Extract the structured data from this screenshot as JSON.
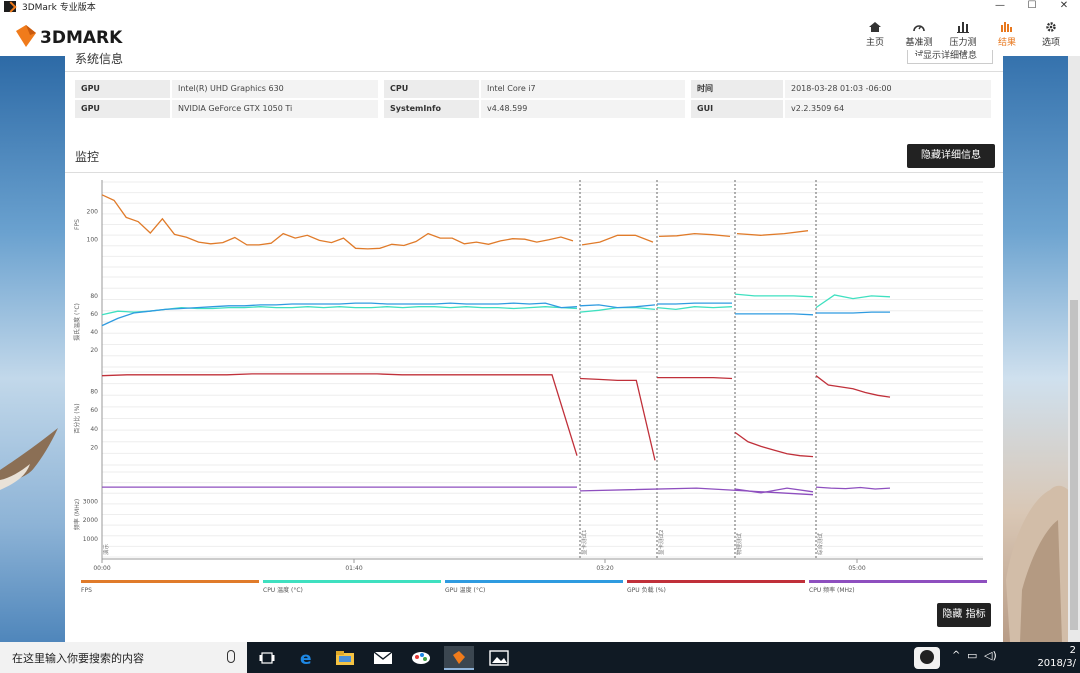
{
  "window": {
    "title": "3DMark 专业版本"
  },
  "app": {
    "logo_text": "3DMARK"
  },
  "nav": [
    {
      "label": "主页",
      "icon": "home-icon"
    },
    {
      "label": "基准测试",
      "icon": "gauge-icon"
    },
    {
      "label": "压力测试",
      "icon": "bars-icon"
    },
    {
      "label": "结果",
      "icon": "results-icon",
      "active": true
    },
    {
      "label": "选项",
      "icon": "gear-icon"
    }
  ],
  "system": {
    "section_title": "系统信息",
    "show_details": "显示详细信息",
    "rows": [
      [
        {
          "k": "GPU",
          "v": "Intel(R) UHD Graphics 630"
        },
        {
          "k": "CPU",
          "v": "Intel Core i7"
        },
        {
          "k": "时间",
          "v": "2018-03-28 01:03 -06:00"
        }
      ],
      [
        {
          "k": "GPU",
          "v": "NVIDIA GeForce GTX 1050 Ti"
        },
        {
          "k": "SystemInfo",
          "v": "v4.48.599"
        },
        {
          "k": "GUI",
          "v": "v2.2.3509 64"
        }
      ]
    ]
  },
  "monitor": {
    "title": "监控",
    "hide_details": "隐藏详细信息",
    "hide_metrics": "隐藏 指标"
  },
  "chart_data": {
    "type": "line",
    "x_ticks": [
      "00:00",
      "01:40",
      "03:20",
      "05:00"
    ],
    "markers": [
      "演示",
      "显卡测试1",
      "显卡测试2",
      "物理测试",
      "综合测试"
    ],
    "panels": [
      {
        "ylabel": "FPS",
        "yticks": [
          100,
          200
        ]
      },
      {
        "ylabel": "摄氏温度 (°C)",
        "yticks": [
          20,
          40,
          60,
          80
        ]
      },
      {
        "ylabel": "百分比 (%)",
        "yticks": [
          20,
          40,
          60,
          80
        ]
      },
      {
        "ylabel": "频率 (MHz)",
        "yticks": [
          1000,
          2000,
          3000
        ]
      }
    ],
    "series": [
      {
        "name": "FPS",
        "color": "#e07b2a"
      },
      {
        "name": "CPU 温度 (°C)",
        "color": "#3fe0c0"
      },
      {
        "name": "GPU 温度 (°C)",
        "color": "#2f9be0"
      },
      {
        "name": "GPU 负载 (%)",
        "color": "#c0303a"
      },
      {
        "name": "CPU 频率 (MHz)",
        "color": "#8e4fbf"
      }
    ],
    "fps_y": [
      255,
      235,
      175,
      160,
      120,
      170,
      115,
      105,
      88,
      82,
      86,
      104,
      78,
      78,
      84,
      118,
      102,
      112,
      94,
      86,
      102,
      66,
      64,
      66,
      80,
      76,
      90,
      118,
      102,
      102,
      82,
      88,
      80,
      92,
      100,
      98,
      88,
      96,
      106,
      92,
      78,
      88,
      112,
      112,
      88,
      108,
      110,
      118,
      114,
      108,
      118,
      112,
      118,
      128
    ],
    "cpu_temp_y": [
      58,
      62,
      61,
      62,
      64,
      66,
      65,
      65,
      66,
      66,
      67,
      66,
      66,
      67,
      66,
      67,
      66,
      66,
      67,
      66,
      67,
      67,
      66,
      67,
      66,
      66,
      65,
      66,
      67,
      66,
      65,
      61,
      63,
      66,
      66,
      64,
      66,
      64,
      67,
      66,
      67,
      81,
      79,
      79,
      79,
      78,
      66,
      80,
      76,
      79,
      78
    ],
    "gpu_temp_y": [
      46,
      54,
      60,
      62,
      64,
      65,
      66,
      67,
      68,
      68,
      69,
      69,
      70,
      70,
      70,
      70,
      71,
      71,
      70,
      70,
      70,
      70,
      71,
      70,
      70,
      70,
      71,
      70,
      71,
      66,
      67,
      68,
      69,
      66,
      67,
      69,
      70,
      70,
      71,
      71,
      71,
      59,
      59,
      59,
      59,
      58,
      60,
      60,
      60,
      61,
      61
    ],
    "gpu_load_y": [
      96,
      97,
      97,
      97,
      97,
      97,
      98,
      98,
      98,
      98,
      98,
      98,
      97,
      97,
      97,
      97,
      97,
      97,
      97,
      10,
      93,
      92,
      91,
      91,
      5,
      94,
      94,
      94,
      94,
      93,
      35,
      25,
      20,
      16,
      12,
      10,
      9,
      96,
      86,
      84,
      82,
      78,
      75,
      73
    ],
    "cpu_freq_y": [
      3700,
      3700,
      3700,
      3700,
      3700,
      3700,
      3700,
      3700,
      3700,
      3700,
      3700,
      3700,
      3700,
      3700,
      3700,
      3700,
      3700,
      3700,
      3700,
      3700,
      3700,
      3700,
      3700,
      3700,
      3700,
      3700,
      3500,
      3650,
      3300,
      3600,
      3400,
      3650,
      3450,
      3700,
      3650,
      3620,
      3680,
      3600,
      3650
    ]
  },
  "taskbar": {
    "search_placeholder": "在这里输入你要搜索的内容",
    "clock_time": "2",
    "clock_date": "2018/3/"
  }
}
